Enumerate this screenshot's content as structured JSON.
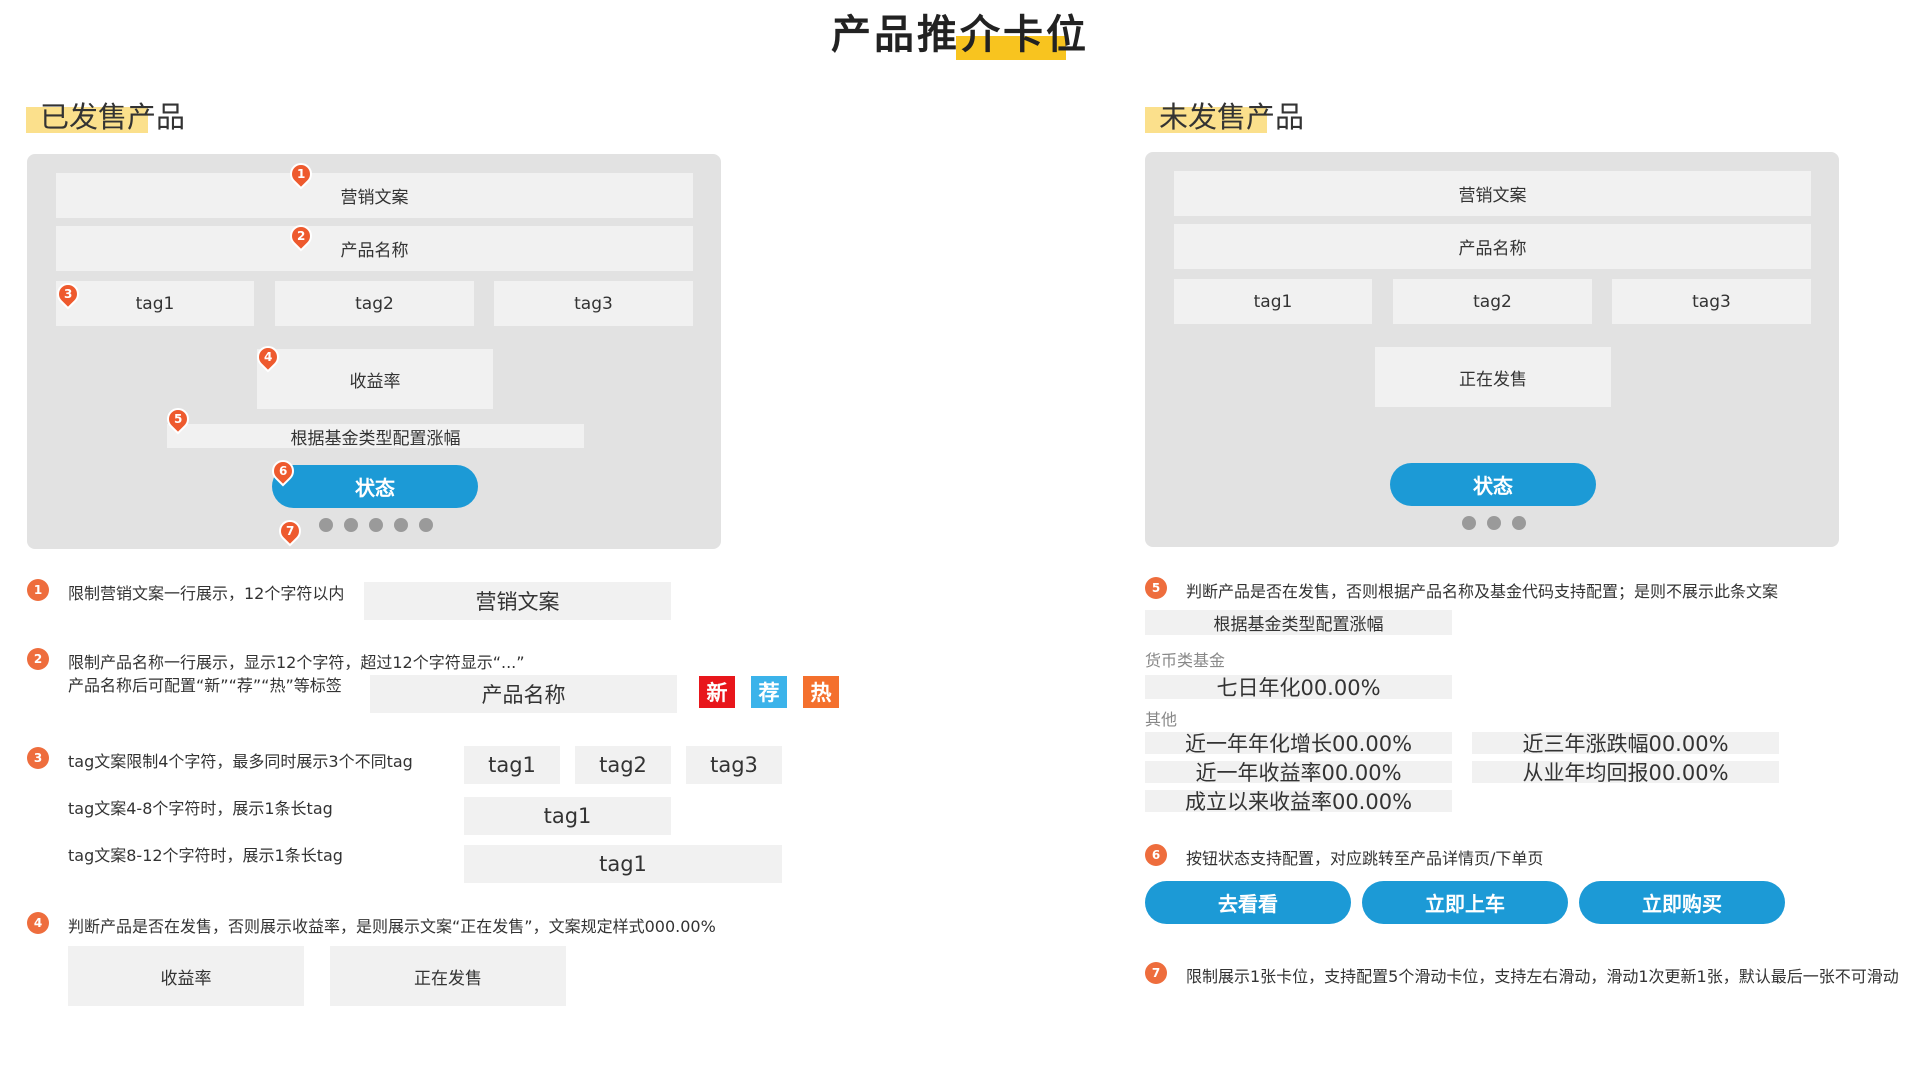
{
  "page_title": "产品推介卡位",
  "left": {
    "section_title": "已发售产品",
    "card": {
      "marketing": "营销文案",
      "product_name": "产品名称",
      "tags": [
        "tag1",
        "tag2",
        "tag3"
      ],
      "yield_label": "收益率",
      "subtitle": "根据基金类型配置涨幅",
      "status_button": "状态",
      "pins": [
        "1",
        "2",
        "3",
        "4",
        "5",
        "6",
        "7"
      ]
    },
    "notes": {
      "n1": {
        "num": "1",
        "text": "限制营销文案一行展示，12个字符以内",
        "sample": "营销文案"
      },
      "n2": {
        "num": "2",
        "text_line1": "限制产品名称一行展示，显示12个字符，超过12个字符显示“...”",
        "text_line2": "产品名称后可配置“新”“荐”“热”等标签",
        "sample": "产品名称",
        "badges": [
          "新",
          "荐",
          "热"
        ]
      },
      "n3": {
        "num": "3",
        "text_a": "tag文案限制4个字符，最多同时展示3个不同tag",
        "tags_a": [
          "tag1",
          "tag2",
          "tag3"
        ],
        "text_b": "tag文案4-8个字符时，展示1条长tag",
        "tag_b": "tag1",
        "text_c": "tag文案8-12个字符时，展示1条长tag",
        "tag_c": "tag1"
      },
      "n4": {
        "num": "4",
        "text": "判断产品是否在发售，否则展示收益率，是则展示文案“正在发售”，文案规定样式000.00%",
        "box1": "收益率",
        "box2": "正在发售"
      }
    }
  },
  "right": {
    "section_title": "未发售产品",
    "card": {
      "marketing": "营销文案",
      "product_name": "产品名称",
      "tags": [
        "tag1",
        "tag2",
        "tag3"
      ],
      "on_sale": "正在发售",
      "status_button": "状态"
    },
    "notes": {
      "n5": {
        "num": "5",
        "text": "判断产品是否在发售，否则根据产品名称及基金代码支持配置；是则不展示此条文案",
        "sample": "根据基金类型配置涨幅",
        "money_label": "货币类基金",
        "money_value": "七日年化00.00%",
        "other_label": "其他",
        "others": [
          "近一年年化增长00.00%",
          "近三年涨跌幅00.00%",
          "近一年收益率00.00%",
          "从业年均回报00.00%",
          "成立以来收益率00.00%"
        ]
      },
      "n6": {
        "num": "6",
        "text": "按钮状态支持配置，对应跳转至产品详情页/下单页",
        "buttons": [
          "去看看",
          "立即上车",
          "立即购买"
        ]
      },
      "n7": {
        "num": "7",
        "text": "限制展示1张卡位，支持配置5个滑动卡位，支持左右滑动，滑动1次更新1张，默认最后一张不可滑动"
      }
    }
  },
  "colors": {
    "accent_blue": "#1c9ad6",
    "pin_orange": "#ee5a2e",
    "highlight_yellow": "#f8c41f",
    "badge_new": "#e8161b",
    "badge_rec": "#3bb3ea",
    "badge_hot": "#f4702d"
  }
}
